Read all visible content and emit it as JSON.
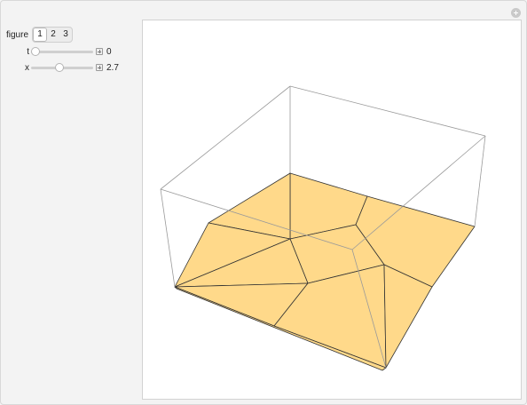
{
  "controls": {
    "figure": {
      "label": "figure",
      "options": [
        "1",
        "2",
        "3"
      ],
      "selected": "1"
    },
    "sliders": [
      {
        "label": "t",
        "value": "0",
        "level": 0.0
      },
      {
        "label": "x",
        "value": "2.7",
        "level": 0.45
      }
    ]
  },
  "colors": {
    "face_fill": "#ffd98a",
    "edge": "#333333",
    "box": "#9a9a9a"
  }
}
